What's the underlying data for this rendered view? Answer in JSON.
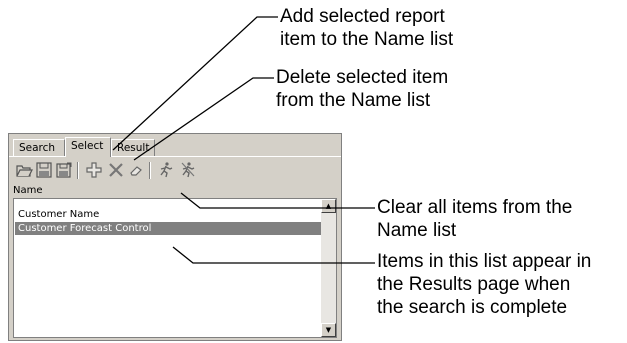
{
  "callouts": {
    "add": "Add selected report\nitem to the Name list",
    "delete": "Delete selected item\nfrom the Name list",
    "clear": "Clear all items from the\nName list",
    "items": "Items in this list appear in\nthe Results page when\nthe search is complete"
  },
  "panel": {
    "tabs": [
      "Search",
      "Select",
      "Result"
    ],
    "active_tab": "Select",
    "toolbar": [
      "open-folder-icon",
      "save-icon",
      "save-as-icon",
      "add-icon",
      "delete-icon",
      "clear-icon",
      "run-icon",
      "run-all-icon"
    ],
    "list_header": "Name",
    "items": [
      {
        "label": "Customer Name",
        "selected": false
      },
      {
        "label": "Customer Forecast Control",
        "selected": true
      }
    ],
    "selection_color": "#808080"
  }
}
